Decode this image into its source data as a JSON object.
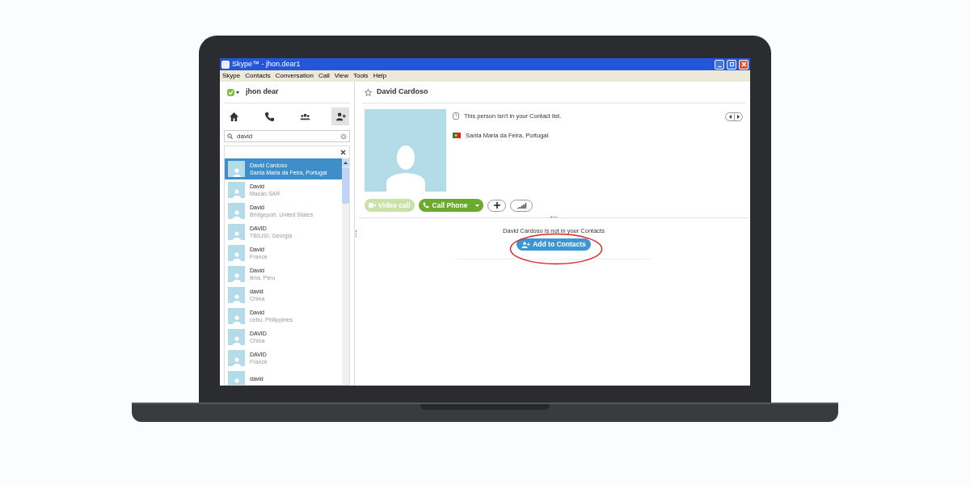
{
  "window": {
    "title": "Skype™ - jhon.dear1"
  },
  "menu": [
    "Skype",
    "Contacts",
    "Conversation",
    "Call",
    "View",
    "Tools",
    "Help"
  ],
  "profile": {
    "name": "jhon dear"
  },
  "nav_tabs": [
    {
      "kind": "home",
      "selected": false
    },
    {
      "kind": "calls",
      "selected": false
    },
    {
      "kind": "group",
      "selected": false
    },
    {
      "kind": "add-contact",
      "selected": true
    }
  ],
  "search": {
    "value": "david"
  },
  "results": [
    {
      "name": "David Cardoso",
      "location": "Santa Maria da Feira, Portugal",
      "selected": true
    },
    {
      "name": "David",
      "location": "Macao SAR",
      "selected": false
    },
    {
      "name": "David",
      "location": "Bridgeport, United States",
      "selected": false
    },
    {
      "name": "DAVID",
      "location": "TBILISI, Georgia",
      "selected": false
    },
    {
      "name": "David",
      "location": "France",
      "selected": false
    },
    {
      "name": "David",
      "location": "lima, Peru",
      "selected": false
    },
    {
      "name": "david",
      "location": "China",
      "selected": false
    },
    {
      "name": "David",
      "location": "cebu, Philippines",
      "selected": false
    },
    {
      "name": "DAVID",
      "location": "China",
      "selected": false
    },
    {
      "name": "DAVID",
      "location": "France",
      "selected": false
    },
    {
      "name": "david",
      "selected": false
    }
  ],
  "contact": {
    "name": "David Cardoso",
    "notice": "This person isn't in your Contact list.",
    "location": "Santa Maria da Feira, Portugal",
    "buttons": [
      {
        "kind": "video",
        "label": "Video call",
        "disabled": true
      },
      {
        "kind": "phone",
        "label": "Call Phone",
        "disabled": false
      }
    ],
    "prompt": "David Cardoso is not in your Contacts",
    "add_button": "Add to Contacts"
  }
}
